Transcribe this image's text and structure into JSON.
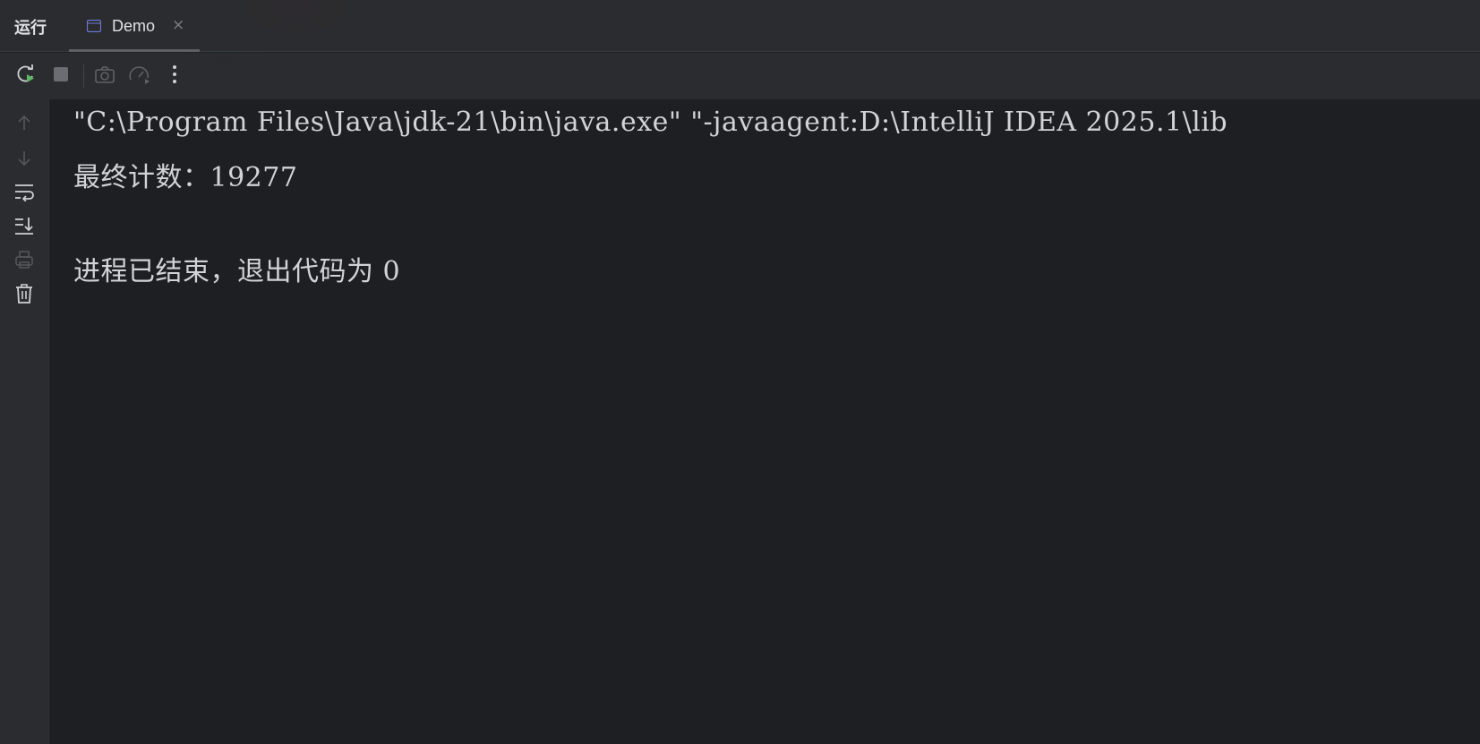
{
  "header": {
    "title": "运行",
    "tab": {
      "label": "Demo",
      "close": "×"
    }
  },
  "toolbar": {
    "buttons": [
      "rerun-icon",
      "stop-icon",
      "camera-icon",
      "gauge-icon",
      "more-icon"
    ]
  },
  "gutter": {
    "buttons": [
      "arrow-up-icon",
      "arrow-down-icon",
      "soft-wrap-icon",
      "scroll-to-end-icon",
      "print-icon",
      "trash-icon"
    ]
  },
  "console": {
    "lines": [
      "\"C:\\Program Files\\Java\\jdk-21\\bin\\java.exe\" \"-javaagent:D:\\IntelliJ IDEA 2025.1\\lib",
      "最终计数：19277",
      "",
      "进程已结束，退出代码为 0"
    ]
  },
  "colors": {
    "background": "#1e1f22",
    "panel": "#2b2d30",
    "text": "#dfe1e5",
    "run_green": "#5fb865"
  }
}
